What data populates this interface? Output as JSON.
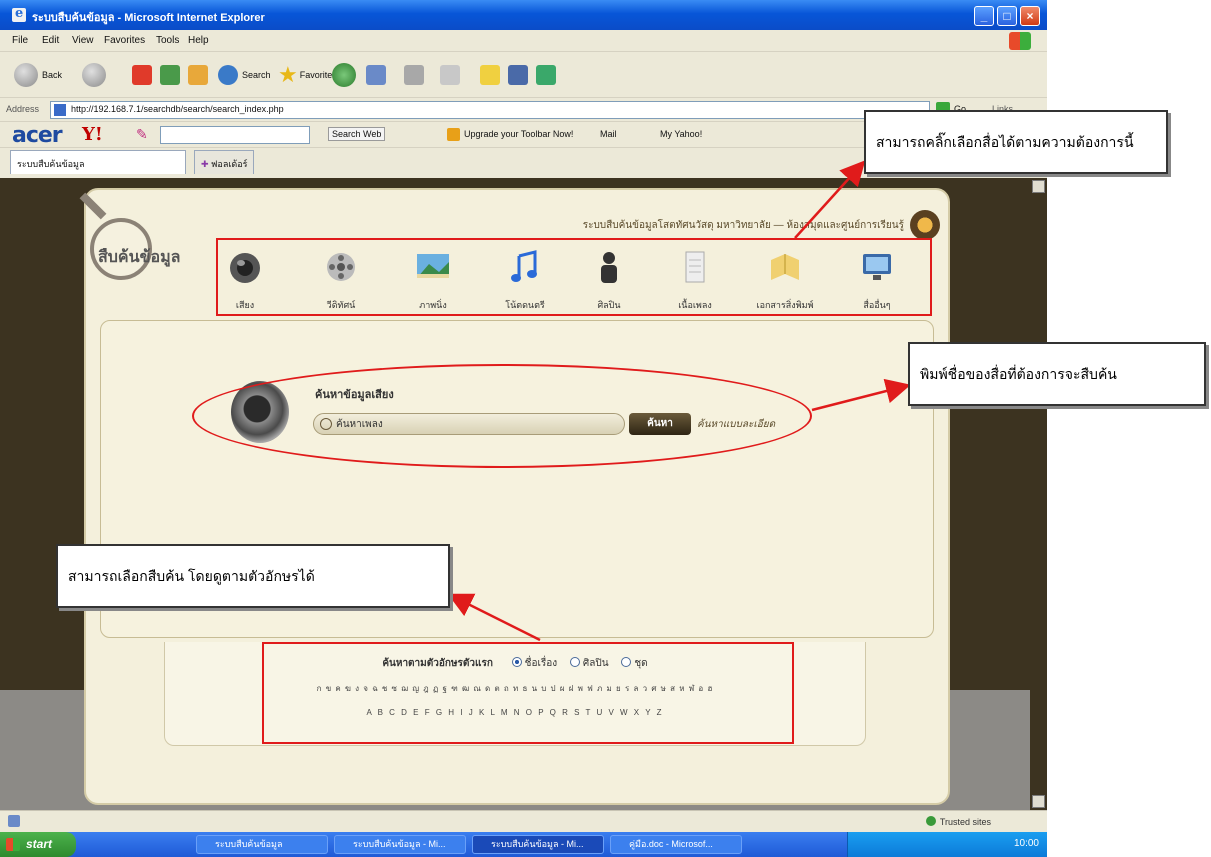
{
  "window": {
    "title": "ระบบสืบค้นข้อมูล - Microsoft Internet Explorer",
    "controls": [
      "_",
      "□",
      "×"
    ]
  },
  "menubar": [
    "File",
    "Edit",
    "View",
    "Favorites",
    "Tools",
    "Help"
  ],
  "toolbar": {
    "back": "Back",
    "search": "Search",
    "favorites": "Favorites"
  },
  "address": {
    "label": "Address",
    "url": "http://192.168.7.1/searchdb/search/search_index.php",
    "go": "Go",
    "links": "Links"
  },
  "acer_bar": {
    "logo": "acer",
    "yahoo": "Y!",
    "search_web": "Search Web",
    "upgrade": "Upgrade your Toolbar Now!",
    "mail": "Mail",
    "my_yahoo": "My Yahoo!"
  },
  "tabs": [
    {
      "label": "ระบบสืบค้นข้อมูล"
    },
    {
      "label": "ฟอลเด้อร์"
    }
  ],
  "site": {
    "logo_text": "สืบค้นข้อมูล",
    "header_text": "ระบบสืบค้นข้อมูลโสตทัศนวัสดุ มหาวิทยาลัย — ห้องสมุดและศูนย์การเรียนรู้",
    "categories": [
      {
        "label": "เสียง"
      },
      {
        "label": "วีดิทัศน์"
      },
      {
        "label": "ภาพนิ่ง"
      },
      {
        "label": "โน้ตดนตรี"
      },
      {
        "label": "ศิลปิน"
      },
      {
        "label": "เนื้อเพลง"
      },
      {
        "label": "เอกสารสิ่งพิมพ์"
      },
      {
        "label": "สื่ออื่นๆ"
      }
    ],
    "search": {
      "title": "ค้นหาข้อมูลเสียง",
      "value": "ค้นหาเพลง",
      "button": "ค้นหา",
      "advanced": "ค้นหาแบบละเอียด"
    },
    "alphabet": {
      "lead": "ค้นหาตามตัวอักษรตัวแรก",
      "options": [
        {
          "label": "ชื่อเรื่อง",
          "selected": true
        },
        {
          "label": "ศิลปิน",
          "selected": false
        },
        {
          "label": "ชุด",
          "selected": false
        }
      ],
      "thai": "ก ข ค ฆ ง จ ฉ ช ซ ฌ ญ ฎ ฏ ฐ ฑ ฒ ณ ด ต ถ ท ธ น บ ป ผ ฝ พ ฟ ภ ม ย ร ล ว ศ ษ ส ห ฬ อ ฮ",
      "latin": "A B C D E F G H I J K L M N O P Q R S T U V W X Y Z"
    }
  },
  "statusbar": {
    "zone": "Trusted sites"
  },
  "taskbar": {
    "start": "start",
    "tasks": [
      "ระบบสืบค้นข้อมูล",
      "ระบบสืบค้นข้อมูล - Mi...",
      "ระบบสืบค้นข้อมูล - Mi...",
      "คู่มือ.doc - Microsof..."
    ],
    "clock": "10:00"
  },
  "annotations": {
    "top_right": "สามารถคลิ๊กเลือกสื่อได้ตามความต้องการนี้",
    "middle_right": "พิมพ์ชื่อของสื่อที่ต้องการจะสืบค้น",
    "bottom_left": "สามารถเลือกสืบค้น โดยดูตามตัวอักษรได้"
  },
  "colors": {
    "accent_red": "#e01b1b",
    "page_dark": "#3c3320",
    "site_bg": "#f4f0dc"
  }
}
